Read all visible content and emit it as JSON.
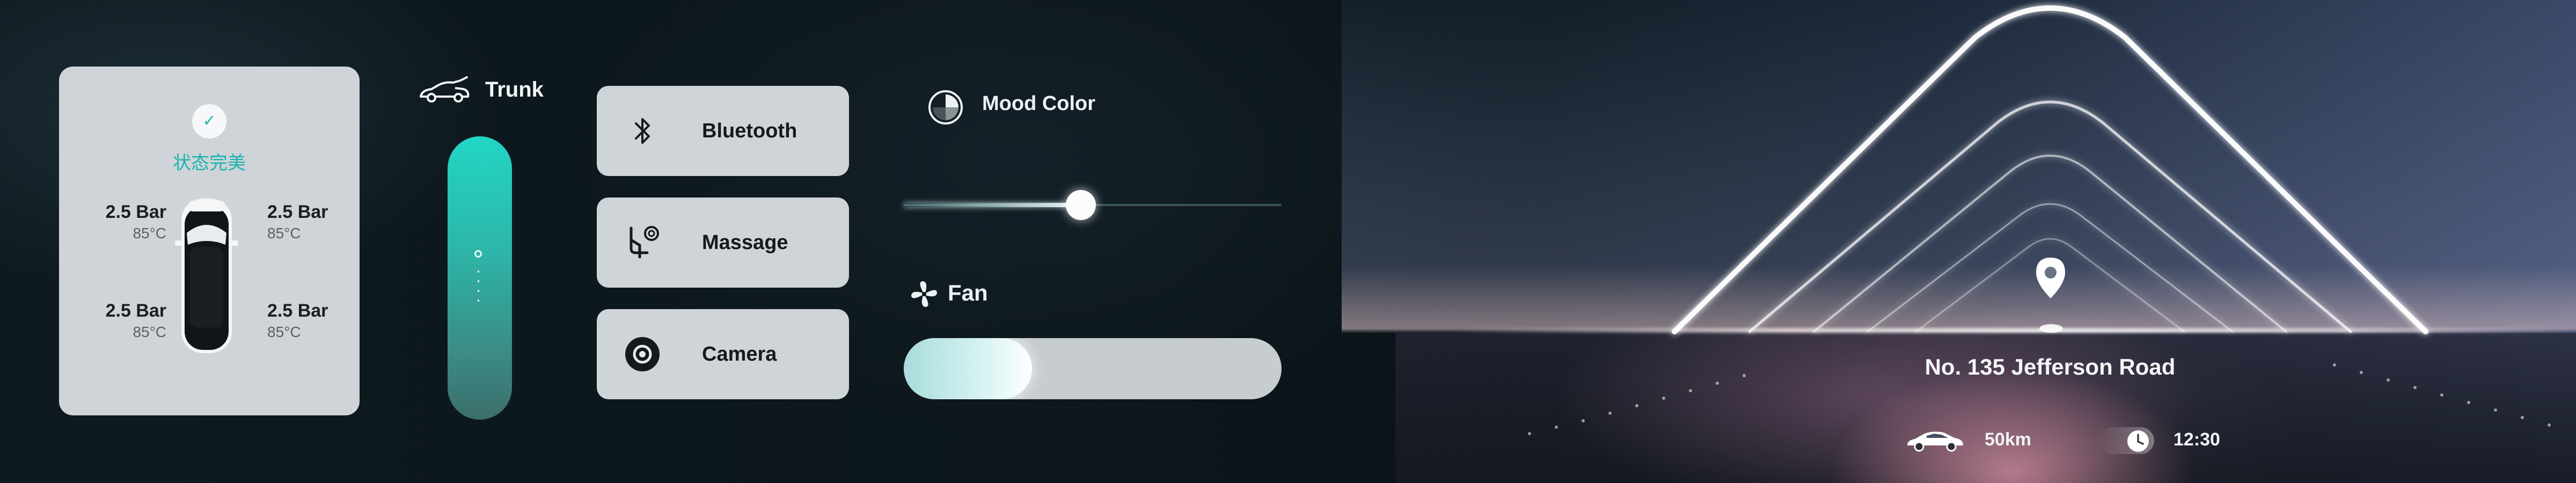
{
  "tire_status": {
    "status_text": "状态完美",
    "tires": [
      {
        "position": "front-left",
        "pressure": "2.5 Bar",
        "temp": "85°C"
      },
      {
        "position": "front-right",
        "pressure": "2.5 Bar",
        "temp": "85°C"
      },
      {
        "position": "rear-left",
        "pressure": "2.5 Bar",
        "temp": "85°C"
      },
      {
        "position": "rear-right",
        "pressure": "2.5 Bar",
        "temp": "85°C"
      }
    ]
  },
  "trunk": {
    "label": "Trunk",
    "open_level": 0.4
  },
  "buttons": [
    {
      "label": "Bluetooth",
      "icon": "bluetooth-icon"
    },
    {
      "label": "Massage",
      "icon": "massage-seat-icon"
    },
    {
      "label": "Camera",
      "icon": "camera-icon"
    }
  ],
  "mood_color": {
    "label": "Mood Color",
    "level": 0.47
  },
  "fan": {
    "label": "Fan",
    "level": 0.34
  },
  "navigation": {
    "address": "No. 135 Jefferson Road",
    "distance": "50km",
    "time": "12:30"
  },
  "colors": {
    "accent": "#1cb8b3",
    "card": "#cfd4d8"
  }
}
